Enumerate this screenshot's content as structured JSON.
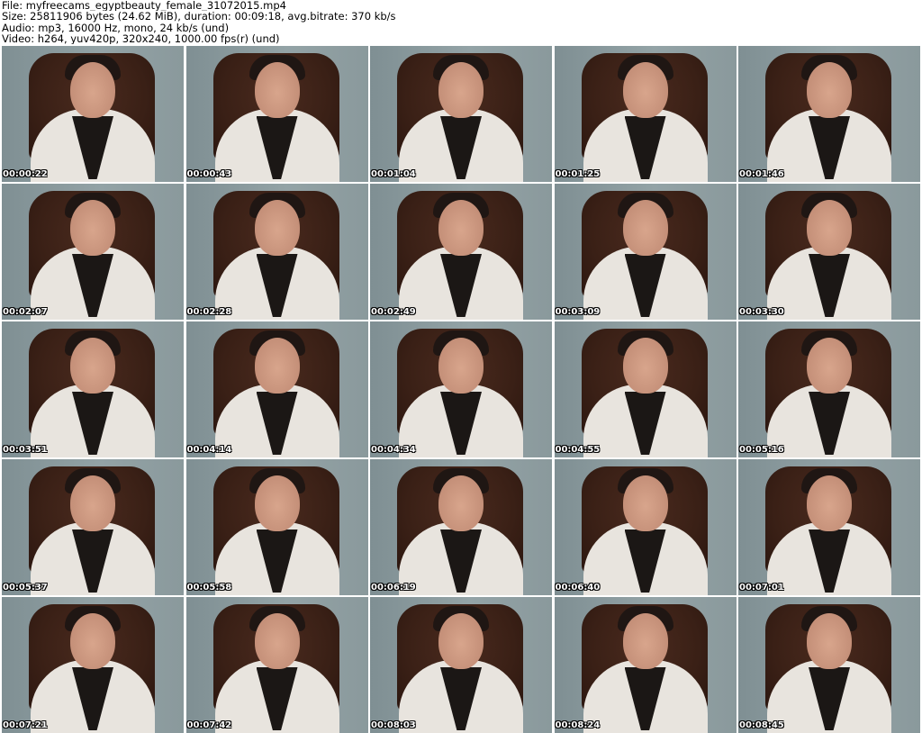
{
  "header": {
    "file_line": "File: myfreecams_egyptbeauty_female_31072015.mp4",
    "size_line": "Size: 25811906 bytes (24.62 MiB), duration: 00:09:18, avg.bitrate: 370 kb/s",
    "audio_line": "Audio: mp3, 16000 Hz, mono, 24 kb/s (und)",
    "video_line": "Video: h264, yuv420p, 320x240, 1000.00 fps(r) (und)"
  },
  "thumbnails": [
    {
      "timestamp": "00:00:22"
    },
    {
      "timestamp": "00:00:43"
    },
    {
      "timestamp": "00:01:04"
    },
    {
      "timestamp": "00:01:25"
    },
    {
      "timestamp": "00:01:46"
    },
    {
      "timestamp": "00:02:07"
    },
    {
      "timestamp": "00:02:28"
    },
    {
      "timestamp": "00:02:49"
    },
    {
      "timestamp": "00:03:09"
    },
    {
      "timestamp": "00:03:30"
    },
    {
      "timestamp": "00:03:51"
    },
    {
      "timestamp": "00:04:14"
    },
    {
      "timestamp": "00:04:34"
    },
    {
      "timestamp": "00:04:55"
    },
    {
      "timestamp": "00:05:16"
    },
    {
      "timestamp": "00:05:37"
    },
    {
      "timestamp": "00:05:58"
    },
    {
      "timestamp": "00:06:19"
    },
    {
      "timestamp": "00:06:40"
    },
    {
      "timestamp": "00:07:01"
    },
    {
      "timestamp": "00:07:21"
    },
    {
      "timestamp": "00:07:42"
    },
    {
      "timestamp": "00:08:03"
    },
    {
      "timestamp": "00:08:24"
    },
    {
      "timestamp": "00:08:45"
    }
  ]
}
